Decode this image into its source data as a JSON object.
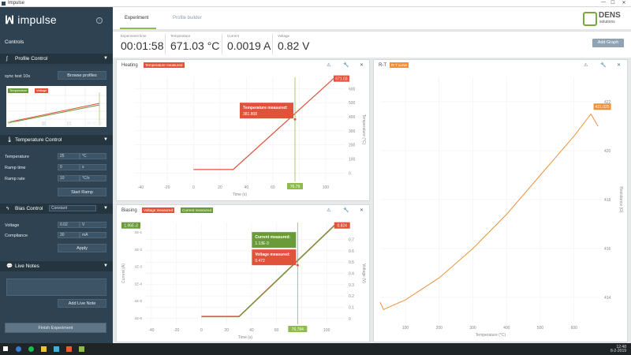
{
  "window": {
    "title": "Impulse",
    "minimize": "—",
    "maximize": "☐",
    "close": "✕"
  },
  "sidebar": {
    "app_name": "impulse",
    "info_icon": "i",
    "controls_label": "Controls",
    "profile_control": {
      "title": "Profile Control",
      "profile_name": "sync test 10s",
      "browse_label": "Browse profiles",
      "legend_temp": "Temperature",
      "legend_volt": "Voltage",
      "time_start": "00:01:11",
      "time_end": "00:01:48"
    },
    "temperature_control": {
      "title": "Temperature Control",
      "fields": [
        {
          "label": "Temperature",
          "value": "25",
          "unit": "°C"
        },
        {
          "label": "Ramp time",
          "value": "0",
          "unit": "s"
        },
        {
          "label": "Ramp rate",
          "value": "10",
          "unit": "°C/s"
        }
      ],
      "start_label": "Start Ramp"
    },
    "bias_control": {
      "title": "Bias Control",
      "mode": "Constant",
      "fields": [
        {
          "label": "Voltage",
          "value": "0.02",
          "unit": "V"
        },
        {
          "label": "Compliance",
          "value": "30",
          "unit": "mA"
        }
      ],
      "apply_label": "Apply"
    },
    "live_notes": {
      "title": "Live Notes",
      "add_label": "Add Live Note"
    },
    "finish_label": "Finish Experiment"
  },
  "tabs": [
    {
      "label": "Experiment"
    },
    {
      "label": "Profile builder"
    }
  ],
  "brand": {
    "line1": "DENS",
    "line2": "solutions"
  },
  "readouts": [
    {
      "label": "Experiment time",
      "value": "00:01:58"
    },
    {
      "label": "Temperature",
      "value": "671.03 °C"
    },
    {
      "label": "Current",
      "value": "0.0019 A"
    },
    {
      "label": "Voltage",
      "value": "0.82 V"
    }
  ],
  "add_graph_label": "Add Graph",
  "panels": {
    "heating": {
      "title": "Heating",
      "badge": "Temperature measured",
      "tooltip_title": "Temperature measured:",
      "tooltip_value": "381.808",
      "end_label": "671.03",
      "cursor_label": "76.79",
      "xlabel": "Time (s)",
      "ylabel": "Temperature (°C)"
    },
    "biasing": {
      "title": "Biasing",
      "badge1": "Voltage measured",
      "badge2": "Current measured",
      "tooltip1_title": "Current measured:",
      "tooltip1_value": "1.13E-3",
      "tooltip2_title": "Voltage measured:",
      "tooltip2_value": "0.472",
      "left_flag": "1.95E-3",
      "right_flag": "0.824",
      "cursor_label": "76.784",
      "xlabel": "Time (s)",
      "ylabel_left": "Current (A)",
      "ylabel_right": "Voltage (V)"
    },
    "rt": {
      "title": "R-T",
      "badge": "R-T curve",
      "end_label": "421.025",
      "xlabel": "Temperature (°C)",
      "ylabel": "Resistance (Ω)"
    }
  },
  "taskbar": {
    "time": "12:48",
    "date": "8-2-2019"
  },
  "chart_data": [
    {
      "type": "line",
      "title": "Heating",
      "xlabel": "Time (s)",
      "ylabel": "Temperature (°C)",
      "xticks": [
        -40,
        -20,
        0,
        20,
        40,
        60,
        80,
        100
      ],
      "yticks": [
        0,
        100,
        200,
        300,
        400,
        500,
        600
      ],
      "xlim": [
        -45,
        115
      ],
      "ylim": [
        -60,
        680
      ],
      "series": [
        {
          "name": "Temperature measured",
          "x": [
            0,
            30,
            106
          ],
          "y": [
            25,
            25,
            671
          ]
        }
      ],
      "colors": {
        "series": "#e0523a",
        "cursor": "#8dbb4c"
      }
    },
    {
      "type": "line",
      "title": "Biasing",
      "xlabel": "Time (s)",
      "ylabel": "Current (A)",
      "xticks": [
        -40,
        -20,
        0,
        20,
        40,
        60,
        80,
        100
      ],
      "yticks_left": [
        "1E-1",
        "1E-2",
        "1E-3",
        "1E-4",
        "1E-5",
        "1E-6"
      ],
      "yticks_right": [
        0,
        0.1,
        0.2,
        0.3,
        0.4,
        0.5,
        0.6,
        0.7
      ],
      "xlim": [
        -45,
        115
      ],
      "ylim_right": [
        -0.05,
        0.85
      ],
      "series": [
        {
          "name": "Voltage measured",
          "x": [
            0,
            30,
            106
          ],
          "y": [
            0.02,
            0.02,
            0.824
          ]
        },
        {
          "name": "Current measured",
          "x": [
            0,
            30,
            106
          ],
          "y": [
            0.02,
            0.02,
            0.824
          ]
        }
      ],
      "colors": {
        "voltage": "#e0523a",
        "current": "#6a9a3a"
      }
    },
    {
      "type": "line",
      "title": "R-T",
      "xlabel": "Temperature (°C)",
      "ylabel": "Resistance (Ω)",
      "xticks": [
        100,
        200,
        300,
        400,
        500,
        600
      ],
      "yticks": [
        414,
        416,
        418,
        420,
        422
      ],
      "xlim": [
        25,
        680
      ],
      "ylim": [
        413,
        423
      ],
      "series": [
        {
          "name": "R-T curve",
          "x": [
            25,
            35,
            50,
            100,
            200,
            300,
            400,
            500,
            600,
            650,
            671
          ],
          "y": [
            413.8,
            413.5,
            413.6,
            413.9,
            414.8,
            416.0,
            417.4,
            419.0,
            420.6,
            421.5,
            421.0
          ]
        }
      ],
      "colors": {
        "series": "#f0913a"
      }
    }
  ]
}
